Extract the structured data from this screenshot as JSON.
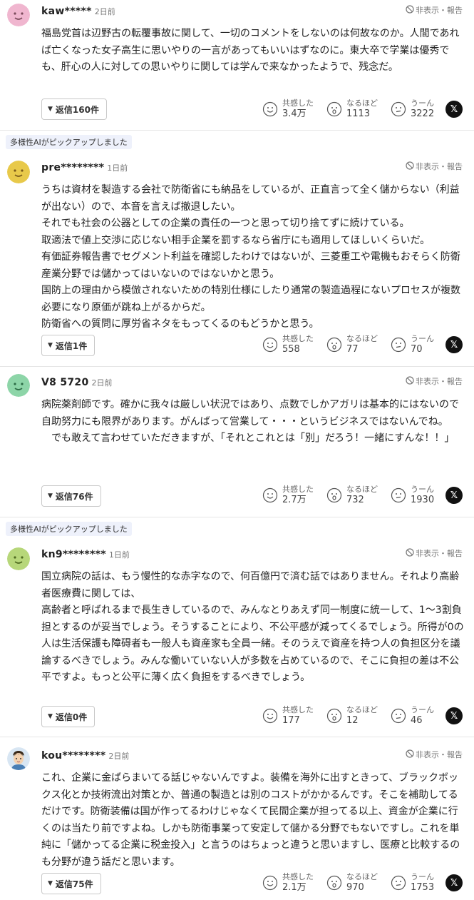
{
  "labels": {
    "report": "非表示・報告",
    "empathy": "共感した",
    "naruhodo": "なるほど",
    "uun": "うーん",
    "x": "𝕏",
    "pickup": "多様性AIがピックアップしました"
  },
  "colors": {
    "avatar_yellow": "#e8c94a",
    "avatar_green": "#8dd5a8",
    "avatar_pink": "#f0b6cf",
    "avatar_lime": "#b7d77a",
    "pickup_bg": "#eef1fb",
    "text": "#222222"
  },
  "comments": [
    {
      "user": "kaw*****",
      "time": "2日前",
      "body": [
        "福島党首は辺野古の転覆事故に関して、一切のコメントをしないのは何故なのか。人間であれば亡くなった女子高生に思いやりの一言があってもいいはずなのに。東大卒で学業は優秀でも、肝心の人に対しての思いやりに関しては学んで来なかったようで、残念だ。"
      ],
      "reply_label": "返信160件",
      "empathy": "3.4万",
      "naruhodo": "1113",
      "uun": "3222"
    },
    {
      "user": "pre********",
      "time": "1日前",
      "body": [
        "うちは資材を製造する会社で防衛省にも納品をしているが、正直言って全く儲からない（利益が出ない）ので、本音を言えば撤退したい。",
        "それでも社会の公器としての企業の責任の一つと思って切り捨てずに続けている。",
        "取適法で値上交渉に応じない相手企業を罰するなら省庁にも適用してほしいくらいだ。",
        "有価証券報告書でセグメント利益を確認したわけではないが、三菱重工や電機もおそらく防衛産業分野では儲かってはいないのではないかと思う。",
        "国防上の理由から模倣されないための特別仕様にしたり通常の製造過程にないプロセスが複数必要になり原価が跳ね上がるからだ。",
        "防衛省への質問に厚労省ネタをもってくるのもどうかと思う。"
      ],
      "reply_label": "返信1件",
      "empathy": "558",
      "naruhodo": "77",
      "uun": "70"
    },
    {
      "user": "V8 5720",
      "time": "2日前",
      "body": [
        "病院薬剤師です。確かに我々は厳しい状況ではあり、点数でしかアガリは基本的にはないので自助努力にも限界があります。がんばって営業して・・・というビジネスではないんでね。",
        "　でも敢えて言わせていただきますが、「それとこれとは「別」だろう！一緒にすんな！！」"
      ],
      "reply_label": "返信76件",
      "empathy": "2.7万",
      "naruhodo": "732",
      "uun": "1930"
    },
    {
      "user": "kn9********",
      "time": "1日前",
      "body": [
        "国立病院の話は、もう慢性的な赤字なので、何百億円で済む話ではありません。それより高齢者医療費に関しては、",
        "高齢者と呼ばれるまで長生きしているので、みんなとりあえず同一制度に統一して、1～3割負担とするのが妥当でしょう。そうすることにより、不公平感が減ってくるでしょう。所得が0の人は生活保護も障碍者も一般人も資産家も全員一緒。そのうえで資産を持つ人の負担区分を議論するべきでしょう。みんな働いていない人が多数を占めているので、そこに負担の差は不公平ですよ。もっと公平に薄く広く負担をするべきでしょう。"
      ],
      "reply_label": "返信0件",
      "empathy": "177",
      "naruhodo": "12",
      "uun": "46"
    },
    {
      "user": "kou********",
      "time": "2日前",
      "body": [
        "これ、企業に金ばらまいてる話じゃないんですよ。装備を海外に出すときって、ブラックボックス化とか技術流出対策とか、普通の製造とは別のコストがかかるんです。そこを補助してるだけです。防衛装備は国が作ってるわけじゃなくて民間企業が担ってる以上、資金が企業に行くのは当たり前ですよね。しかも防衛事業って安定して儲かる分野でもないですし。これを単純に「儲かってる企業に税金投入」と言うのはちょっと違うと思いますし、医療と比較するのも分野が違う話だと思います。"
      ],
      "reply_label": "返信75件",
      "empathy": "2.1万",
      "naruhodo": "970",
      "uun": "1753"
    }
  ]
}
